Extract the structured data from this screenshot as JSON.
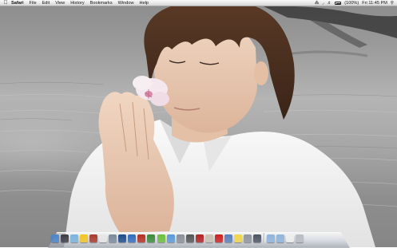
{
  "menubar": {
    "apple_icon": "apple-icon",
    "app_name": "Safari",
    "items": [
      "File",
      "Edit",
      "View",
      "History",
      "Bookmarks",
      "Window",
      "Help"
    ],
    "extras": {
      "battery_percent": "(100%)",
      "clock": "Fri 11:45 PM",
      "icons": [
        "bluetooth-icon",
        "wifi-icon",
        "volume-icon",
        "battery-icon",
        "spotlight-icon"
      ]
    }
  },
  "dock": {
    "apps": [
      {
        "name": "finder",
        "icon": "finder-icon",
        "color": "#4d86c9"
      },
      {
        "name": "dashboard",
        "icon": "dashboard-icon",
        "color": "#3c3c46"
      },
      {
        "name": "safari",
        "icon": "safari-icon",
        "color": "#7ab3de"
      },
      {
        "name": "ichat",
        "icon": "ichat-icon",
        "color": "#f2c623"
      },
      {
        "name": "address-book",
        "icon": "address-book-icon",
        "color": "#a63a2c"
      },
      {
        "name": "ical",
        "icon": "ical-icon",
        "color": "#e6e6e6"
      },
      {
        "name": "preview",
        "icon": "preview-icon",
        "color": "#7a8a9a"
      },
      {
        "name": "photoshop",
        "icon": "photoshop-icon",
        "color": "#1d4c8a"
      },
      {
        "name": "word",
        "icon": "word-icon",
        "color": "#2f6bc0"
      },
      {
        "name": "flash",
        "icon": "flash-icon",
        "color": "#b52e22"
      },
      {
        "name": "dreamweaver",
        "icon": "dreamweaver-icon",
        "color": "#3a8a3a"
      },
      {
        "name": "utorrent",
        "icon": "utorrent-icon",
        "color": "#6cbf3a"
      },
      {
        "name": "itunes",
        "icon": "itunes-icon",
        "color": "#5a9ad8"
      },
      {
        "name": "system-preferences",
        "icon": "gear-icon",
        "color": "#8b8f96"
      },
      {
        "name": "imovie",
        "icon": "star-icon",
        "color": "#555555"
      },
      {
        "name": "photo-booth",
        "icon": "photo-booth-icon",
        "color": "#b22222"
      },
      {
        "name": "iphoto",
        "icon": "iphoto-icon",
        "color": "#c8c0b0"
      },
      {
        "name": "red-app",
        "icon": "red-app-icon",
        "color": "#cc2020"
      },
      {
        "name": "app-store",
        "icon": "app-store-icon",
        "color": "#5b7fb8"
      },
      {
        "name": "stickies",
        "icon": "stickies-icon",
        "color": "#f1d64a"
      },
      {
        "name": "utility",
        "icon": "utility-icon",
        "color": "#8e96a0"
      },
      {
        "name": "time-machine",
        "icon": "time-machine-icon",
        "color": "#4b5563"
      }
    ],
    "stacks": [
      {
        "name": "applications-folder",
        "icon": "folder-icon",
        "color": "#8fb4dc"
      },
      {
        "name": "downloads-folder",
        "icon": "folder-icon",
        "color": "#8fb4dc"
      },
      {
        "name": "documents",
        "icon": "document-icon",
        "color": "#eeeeee"
      },
      {
        "name": "trash",
        "icon": "trash-icon",
        "color": "#b9bcc2"
      }
    ]
  }
}
